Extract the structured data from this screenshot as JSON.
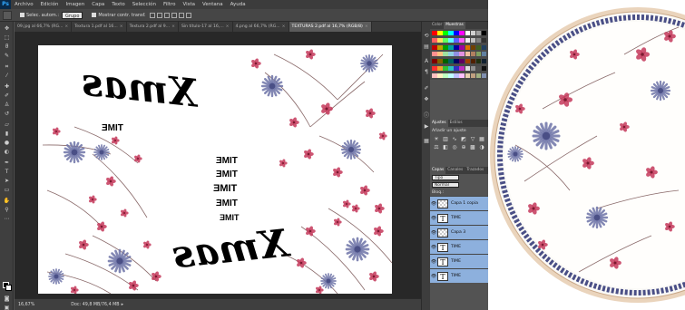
{
  "menubar": {
    "logo": "Ps",
    "items": [
      "Archivo",
      "Edición",
      "Imagen",
      "Capa",
      "Texto",
      "Selección",
      "Filtro",
      "Vista",
      "Ventana",
      "Ayuda"
    ]
  },
  "options": {
    "auto_select_label": "Selec. autom.:",
    "auto_select_value": "Grupo",
    "transform_label": "Mostrar contr. transf."
  },
  "tabs": [
    {
      "label": "09.jpg al 66,7% (RG..."
    },
    {
      "label": "Textura 1.pdf al 16..."
    },
    {
      "label": "Textura 2.pdf al 9..."
    },
    {
      "label": "Sin título-17 al 16,..."
    },
    {
      "label": "4.png al 66,7% (RG..."
    },
    {
      "label": "TEXTURAS 2.pdf al 16,7% (RGB/8)",
      "active": true
    }
  ],
  "canvas": {
    "xmas_text": "Xmas",
    "time_text": "TIME"
  },
  "status": {
    "zoom": "16,67%",
    "doc": "Doc: 49,8 MB/76,4 MB"
  },
  "panels": {
    "swatch_tabs": [
      "Color",
      "Muestras"
    ],
    "adj_tabs": [
      "Ajustes",
      "Estilos"
    ],
    "adj_title": "Añadir un ajuste",
    "layer_tabs": [
      "Capas",
      "Canales",
      "Trazados"
    ],
    "kind_label": "Tipo",
    "blend_mode": "Normal",
    "lock_label": "Bloq.:",
    "layers": [
      {
        "name": "Capa 1 copia",
        "thumb": "img",
        "selected": true
      },
      {
        "name": "TIME",
        "thumb": "T",
        "selected": true
      },
      {
        "name": "Capa 3",
        "thumb": "img",
        "selected": true
      },
      {
        "name": "TIME",
        "thumb": "T",
        "selected": true
      },
      {
        "name": "TIME",
        "thumb": "T",
        "selected": true
      },
      {
        "name": "TIME",
        "thumb": "T",
        "selected": true
      }
    ]
  },
  "colors": {
    "flower_pink": "#c4385a",
    "flower_blue": "#6e74a8",
    "stem": "#8a6a6a",
    "plate_rim": "#d9b89a",
    "plate_border": "#4a4f86"
  },
  "swatches": [
    "#ff0000",
    "#ffff00",
    "#00ff00",
    "#00ffff",
    "#0000ff",
    "#ff00ff",
    "#ffffff",
    "#d0d0d0",
    "#a0a0a0",
    "#000000",
    "#ff6060",
    "#ffe060",
    "#60ff60",
    "#60ffff",
    "#6060ff",
    "#ff60ff",
    "#f0f0f0",
    "#c0c0c0",
    "#808080",
    "#303030",
    "#c00000",
    "#c0a000",
    "#00a000",
    "#00a0a0",
    "#0000a0",
    "#a000a0",
    "#e07000",
    "#704000",
    "#406020",
    "#204060",
    "#ff9090",
    "#ffc080",
    "#a0e0a0",
    "#90d0e0",
    "#9090e0",
    "#e090e0",
    "#f0c0a0",
    "#b08060",
    "#80a060",
    "#6080a0",
    "#800000",
    "#806000",
    "#006000",
    "#006060",
    "#000060",
    "#600060",
    "#a04000",
    "#502000",
    "#203010",
    "#102030",
    "#ff3030",
    "#f0a030",
    "#30c030",
    "#30c0c0",
    "#3030c0",
    "#c030c0",
    "#e0e0e0",
    "#909090",
    "#505050",
    "#101010",
    "#ffc0c0",
    "#fff0c0",
    "#c0ffc0",
    "#c0ffff",
    "#c0c0ff",
    "#ffc0ff",
    "#e8d0b0",
    "#c0a080",
    "#a0b080",
    "#8090b0"
  ]
}
